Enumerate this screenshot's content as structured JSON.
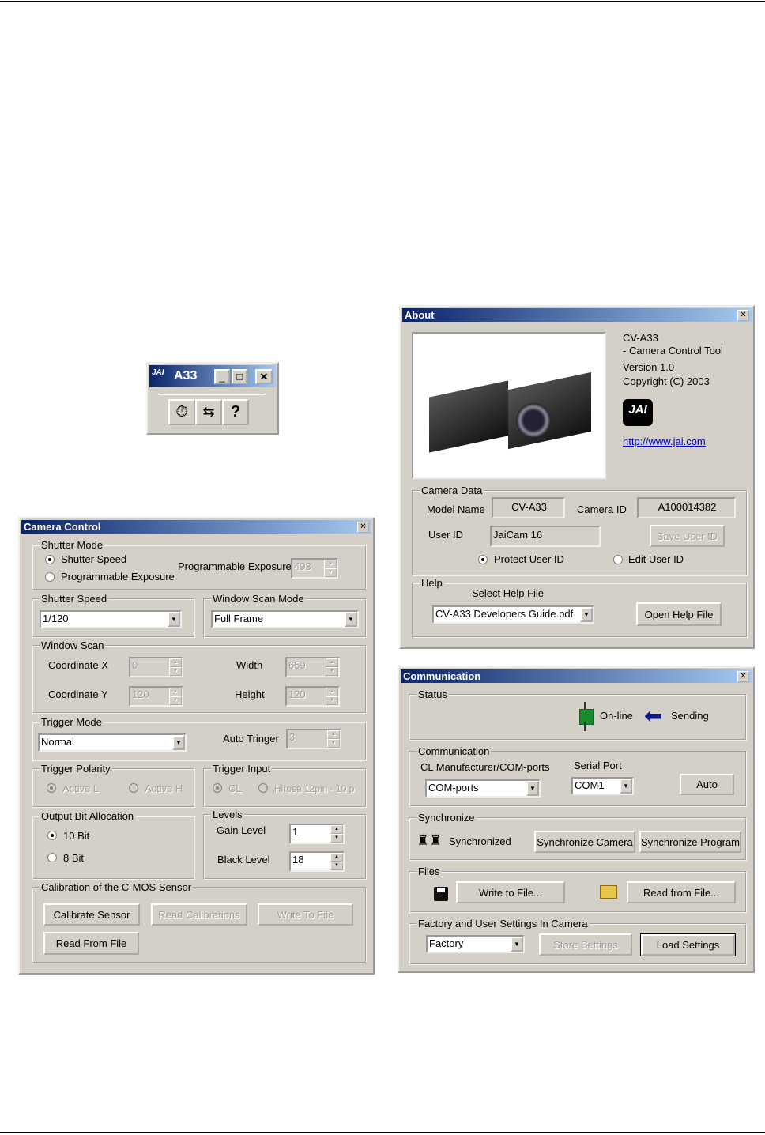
{
  "mini": {
    "title": "A33",
    "buttons": [
      "timer-icon",
      "communication-icon",
      "help-icon"
    ]
  },
  "camera_control": {
    "title": "Camera Control",
    "shutter_mode": {
      "label": "Shutter Mode",
      "opt1": "Shutter Speed",
      "opt2": "Programmable Exposure",
      "exp_label": "Programmable Exposure",
      "exp_value": "493"
    },
    "shutter_speed": {
      "label": "Shutter Speed",
      "value": "1/120"
    },
    "window_scan_mode": {
      "label": "Window Scan Mode",
      "value": "Full Frame"
    },
    "window_scan": {
      "label": "Window Scan",
      "cx_label": "Coordinate X",
      "cx": "0",
      "width_label": "Width",
      "width": "659",
      "cy_label": "Coordinate Y",
      "cy": "120",
      "height_label": "Height",
      "height": "120"
    },
    "trigger_mode": {
      "label": "Trigger Mode",
      "value": "Normal",
      "auto_label": "Auto Tringer",
      "auto_value": "3"
    },
    "trigger_polarity": {
      "label": "Trigger Polarity",
      "opt1": "Active L",
      "opt2": "Active H"
    },
    "trigger_input": {
      "label": "Trigger Input",
      "opt1": "CL",
      "opt2": "Hirose 12pin - 10 p"
    },
    "output_bit": {
      "label": "Output Bit Allocation",
      "opt1": "10 Bit",
      "opt2": "8 Bit"
    },
    "levels": {
      "label": "Levels",
      "gain_label": "Gain Level",
      "gain": "1",
      "black_label": "Black Level",
      "black": "18"
    },
    "calibration": {
      "label": "Calibration of the C-MOS Sensor",
      "calibrate": "Calibrate Sensor",
      "read_cal": "Read Calibrations",
      "write": "Write To File",
      "read_file": "Read From File"
    }
  },
  "about": {
    "title": "About",
    "product": "CV-A33",
    "subtitle": "- Camera Control Tool",
    "version": "Version 1.0",
    "copyright": "Copyright (C) 2003",
    "logo": "JAI",
    "link": "http://www.jai.com",
    "camera_data": {
      "label": "Camera Data",
      "model_label": "Model Name",
      "model": "CV-A33",
      "camid_label": "Camera ID",
      "camid": "A100014382",
      "user_label": "User ID",
      "user": "JaiCam 16",
      "save": "Save User ID",
      "protect": "Protect User ID",
      "edit": "Edit User ID"
    },
    "help": {
      "label": "Help",
      "select_label": "Select Help File",
      "file": "CV-A33 Developers Guide.pdf",
      "open": "Open Help File"
    }
  },
  "communication": {
    "title": "Communication",
    "status": {
      "label": "Status",
      "online": "On-line",
      "sending": "Sending"
    },
    "comm": {
      "label": "Communication",
      "cl_label": "CL Manufacturer/COM-ports",
      "cl_value": "COM-ports",
      "serial_label": "Serial Port",
      "serial_value": "COM1",
      "auto": "Auto"
    },
    "sync": {
      "label": "Synchronize",
      "state": "Synchronized",
      "camera": "Synchronize Camera",
      "program": "Synchronize Program"
    },
    "files": {
      "label": "Files",
      "write": "Write to File...",
      "read": "Read from File..."
    },
    "factory": {
      "label": "Factory and User Settings In Camera",
      "value": "Factory",
      "store": "Store Settings",
      "load": "Load Settings"
    }
  }
}
